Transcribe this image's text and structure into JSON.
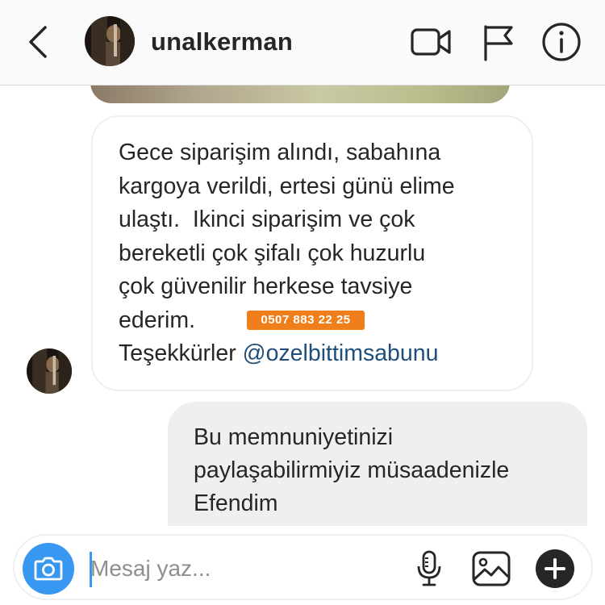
{
  "header": {
    "username": "unalkerman",
    "icons": [
      "back-chevron-icon",
      "video-call-icon",
      "flag-icon",
      "info-icon"
    ]
  },
  "messages": [
    {
      "direction": "incoming",
      "lines": [
        "Gece siparişim alındı, sabahına",
        "kargoya verildi, ertesi günü elime",
        "ulaştı.  Ikinci siparişim ve çok",
        "bereketli çok şifalı çok huzurlu",
        "çok güvenilir herkese tavsiye",
        "ederim."
      ],
      "last_line_prefix": "Teşekkürler ",
      "mention": "@ozelbittimsabunu",
      "phone_badge": "0507 883 22 25"
    },
    {
      "direction": "outgoing",
      "lines": [
        "Bu memnuniyetinizi",
        "paylaşabilirmiyiz müsaadenizle",
        "Efendim"
      ]
    }
  ],
  "composer": {
    "placeholder": "Mesaj yaz...",
    "value": "",
    "icons": [
      "camera-icon",
      "microphone-icon",
      "gallery-icon",
      "plus-icon"
    ]
  },
  "colors": {
    "accent": "#3897f0",
    "mention": "#1e4e79",
    "badge": "#f07f1b",
    "outgoing_bubble": "#efefef"
  }
}
